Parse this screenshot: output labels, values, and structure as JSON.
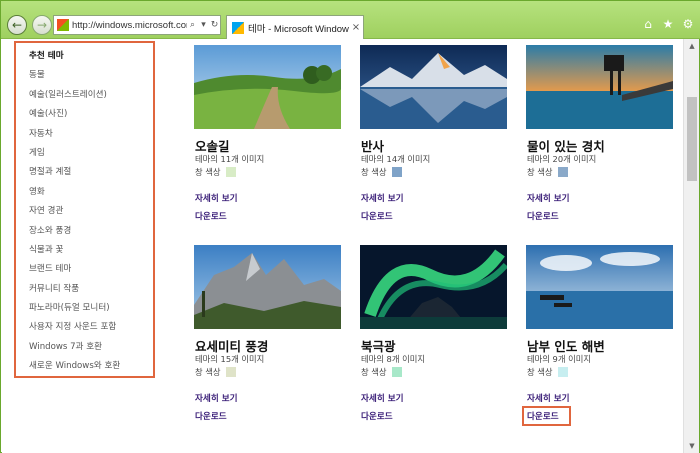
{
  "browser": {
    "url": "http://windows.microsoft.com/ko-k",
    "tab_title": "테마 - Microsoft Windows",
    "tab_close": "×",
    "back_glyph": "←",
    "forward_glyph": "→",
    "search_glyph": "⌕",
    "dropdown_glyph": "▾",
    "refresh_glyph": "↻",
    "home_glyph": "⌂",
    "favorites_glyph": "★",
    "tools_glyph": "⚙",
    "accent_color": "#9fd05f"
  },
  "sidebar": {
    "items": [
      {
        "label": "추천 테마",
        "active": true
      },
      {
        "label": "동물"
      },
      {
        "label": "예술(일러스트레이션)"
      },
      {
        "label": "예술(사진)"
      },
      {
        "label": "자동차"
      },
      {
        "label": "게임"
      },
      {
        "label": "명절과 계절"
      },
      {
        "label": "영화"
      },
      {
        "label": "자연 경관"
      },
      {
        "label": "장소와 풍경"
      },
      {
        "label": "식물과 꽃"
      },
      {
        "label": "브랜드 테마"
      },
      {
        "label": "커뮤니티 작품"
      },
      {
        "label": "파노라마(듀얼 모니터)"
      },
      {
        "label": "사용자 지정 사운드 포함"
      },
      {
        "label": "Windows 7과 호환"
      },
      {
        "label": "새로운 Windows와 호환"
      }
    ]
  },
  "themes": [
    {
      "title": "오솔길",
      "count": "테마의 11개 이미지",
      "color_label": "창 색상",
      "swatch": "#d8ecc6",
      "details": "자세히 보기",
      "download": "다운로드",
      "image_icon": "meadow-path"
    },
    {
      "title": "반사",
      "count": "테마의 14개 이미지",
      "color_label": "창 색상",
      "swatch": "#7fa3c8",
      "details": "자세히 보기",
      "download": "다운로드",
      "image_icon": "mountain-lake"
    },
    {
      "title": "물이 있는 경치",
      "count": "테마의 20개 이미지",
      "color_label": "창 색상",
      "swatch": "#8aa9c9",
      "details": "자세히 보기",
      "download": "다운로드",
      "image_icon": "pier-sunset"
    },
    {
      "title": "요세미티 풍경",
      "count": "테마의 15개 이미지",
      "color_label": "창 색상",
      "swatch": "#dfe3c8",
      "details": "자세히 보기",
      "download": "다운로드",
      "image_icon": "granite-peaks"
    },
    {
      "title": "북극광",
      "count": "테마의 8개 이미지",
      "color_label": "창 색상",
      "swatch": "#a8e8c9",
      "details": "자세히 보기",
      "download": "다운로드",
      "image_icon": "aurora"
    },
    {
      "title": "남부 인도 해변",
      "count": "테마의 9개 이미지",
      "color_label": "창 색상",
      "swatch": "#c7eef0",
      "details": "자세히 보기",
      "download": "다운로드",
      "image_icon": "beach-boats",
      "download_highlighted": true
    }
  ]
}
